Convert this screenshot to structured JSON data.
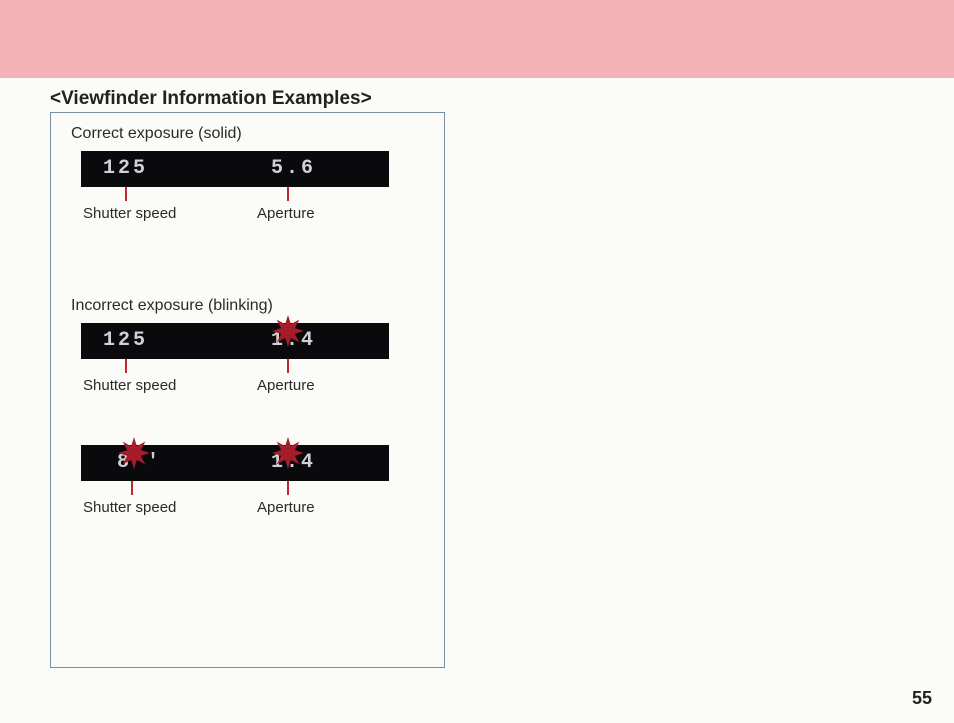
{
  "section_title": "<Viewfinder Information Examples>",
  "page_number": "55",
  "examples": {
    "correct": {
      "heading": "Correct exposure (solid)",
      "shutter_value": "125",
      "aperture_value": "5.6",
      "shutter_label": "Shutter speed",
      "aperture_label": "Aperture"
    },
    "incorrect": {
      "heading": "Incorrect exposure (blinking)",
      "row1": {
        "shutter_value": "125",
        "aperture_value": "1.4",
        "shutter_label": "Shutter speed",
        "aperture_label": "Aperture"
      },
      "row2": {
        "shutter_value": "8''",
        "aperture_value": "1.4",
        "shutter_label": "Shutter speed",
        "aperture_label": "Aperture"
      }
    }
  }
}
